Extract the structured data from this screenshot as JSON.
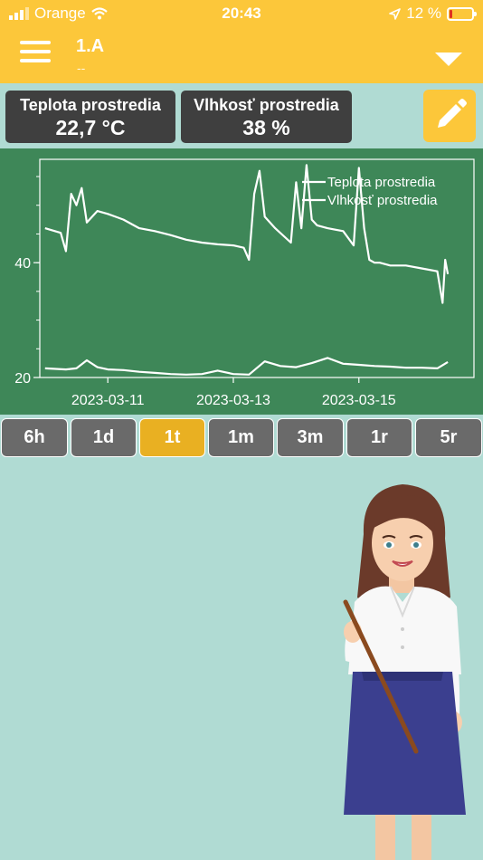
{
  "status_bar": {
    "carrier": "Orange",
    "time": "20:43",
    "battery": "12 %"
  },
  "header": {
    "title": "1.A",
    "subtitle": "--"
  },
  "cards": [
    {
      "label": "Teplota prostredia",
      "value": "22,7 °C"
    },
    {
      "label": "Vlhkosť prostredia",
      "value": "38 %"
    }
  ],
  "ranges": [
    {
      "label": "6h",
      "active": false
    },
    {
      "label": "1d",
      "active": false
    },
    {
      "label": "1t",
      "active": true
    },
    {
      "label": "1m",
      "active": false
    },
    {
      "label": "3m",
      "active": false
    },
    {
      "label": "1r",
      "active": false
    },
    {
      "label": "5r",
      "active": false
    }
  ],
  "colors": {
    "accent": "#fcc73a",
    "chart_bg": "#3e8758",
    "card_bg": "#3f3f3f",
    "page_bg": "#b0dbd3",
    "active_range": "#e9b022"
  },
  "chart_data": {
    "type": "line",
    "title": "",
    "xlabel": "",
    "ylabel": "",
    "x_ticks": [
      "2023-03-11",
      "2023-03-13",
      "2023-03-15"
    ],
    "y_ticks": [
      20,
      40
    ],
    "ylim": [
      20,
      58
    ],
    "xlim": [
      "2023-03-09 22:00",
      "2023-03-16 20:00"
    ],
    "grid": false,
    "legend_position": "top-right",
    "series": [
      {
        "name": "Teplota prostredia",
        "x": [
          "2023-03-10 00:00",
          "2023-03-10 04:00",
          "2023-03-10 08:00",
          "2023-03-10 12:00",
          "2023-03-10 16:00",
          "2023-03-10 20:00",
          "2023-03-11 00:00",
          "2023-03-11 06:00",
          "2023-03-11 12:00",
          "2023-03-11 18:00",
          "2023-03-12 00:00",
          "2023-03-12 06:00",
          "2023-03-12 12:00",
          "2023-03-12 18:00",
          "2023-03-13 00:00",
          "2023-03-13 06:00",
          "2023-03-13 12:00",
          "2023-03-13 18:00",
          "2023-03-14 00:00",
          "2023-03-14 06:00",
          "2023-03-14 12:00",
          "2023-03-14 18:00",
          "2023-03-15 00:00",
          "2023-03-15 06:00",
          "2023-03-15 12:00",
          "2023-03-15 18:00",
          "2023-03-16 00:00",
          "2023-03-16 06:00",
          "2023-03-16 10:00"
        ],
        "y": [
          21.6,
          21.5,
          21.4,
          21.6,
          23.0,
          21.8,
          21.4,
          21.3,
          21.0,
          20.8,
          20.6,
          20.5,
          20.6,
          21.2,
          20.6,
          20.5,
          22.8,
          22.0,
          21.8,
          22.5,
          23.4,
          22.4,
          22.2,
          22.0,
          21.9,
          21.7,
          21.7,
          21.6,
          22.7
        ]
      },
      {
        "name": "Vlhkosť prostredia",
        "x": [
          "2023-03-10 00:00",
          "2023-03-10 06:00",
          "2023-03-10 08:00",
          "2023-03-10 10:00",
          "2023-03-10 12:00",
          "2023-03-10 14:00",
          "2023-03-10 16:00",
          "2023-03-10 20:00",
          "2023-03-11 00:00",
          "2023-03-11 06:00",
          "2023-03-11 12:00",
          "2023-03-11 18:00",
          "2023-03-12 00:00",
          "2023-03-12 06:00",
          "2023-03-12 12:00",
          "2023-03-12 18:00",
          "2023-03-13 00:00",
          "2023-03-13 04:00",
          "2023-03-13 06:00",
          "2023-03-13 08:00",
          "2023-03-13 10:00",
          "2023-03-13 12:00",
          "2023-03-13 16:00",
          "2023-03-13 22:00",
          "2023-03-14 00:00",
          "2023-03-14 02:00",
          "2023-03-14 04:00",
          "2023-03-14 06:00",
          "2023-03-14 08:00",
          "2023-03-14 12:00",
          "2023-03-14 18:00",
          "2023-03-14 22:00",
          "2023-03-15 00:00",
          "2023-03-15 02:00",
          "2023-03-15 04:00",
          "2023-03-15 06:00",
          "2023-03-15 08:00",
          "2023-03-15 12:00",
          "2023-03-15 18:00",
          "2023-03-16 00:00",
          "2023-03-16 06:00",
          "2023-03-16 08:00",
          "2023-03-16 09:00",
          "2023-03-16 10:00"
        ],
        "y": [
          46.0,
          45.2,
          42.0,
          52.0,
          50.0,
          53.0,
          47.0,
          49.0,
          48.5,
          47.5,
          46.0,
          45.5,
          44.8,
          44.0,
          43.5,
          43.2,
          43.0,
          42.6,
          40.5,
          52.0,
          56.0,
          48.0,
          46.0,
          43.5,
          54.0,
          46.0,
          57.0,
          47.5,
          46.5,
          46.0,
          45.5,
          43.0,
          56.5,
          46.0,
          40.5,
          40.0,
          40.0,
          39.5,
          39.5,
          39.0,
          38.5,
          33.0,
          40.5,
          38.0
        ]
      }
    ]
  }
}
